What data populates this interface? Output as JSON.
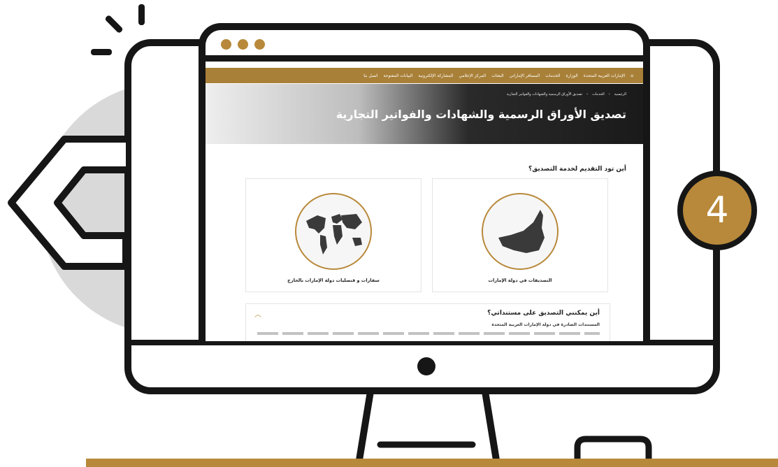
{
  "step": {
    "number": "4"
  },
  "colors": {
    "accent": "#b8893a",
    "outline": "#161616",
    "circle": "#d9d9d9"
  },
  "site": {
    "nav": [
      "الإمارات العربية المتحدة",
      "الوزارة",
      "الخدمات",
      "المسافر الإماراتي",
      "البعثات",
      "المركز الإعلامي",
      "المشاركة الإلكترونية",
      "البيانات المفتوحة",
      "اتصل بنا"
    ],
    "breadcrumb": [
      "الرئيسية",
      "الخدمات",
      "تصديق الأوراق الرسمية والشهادات والفواتير التجارية"
    ],
    "page_title": "تصديق الأوراق الرسمية والشهادات والفواتير التجارية",
    "question": "أين تود التقديم لخدمة التصديق؟",
    "cards": [
      {
        "label": "التصديقات في دولة الإمارات",
        "icon": "uae-map-icon"
      },
      {
        "label": "سفارات و قنصليات دولة الإمارات بالخارج",
        "icon": "world-map-icon"
      }
    ],
    "faq": {
      "title": "أين يمكنني التصديق على مستنداتي؟",
      "subtitle": "المستندات الصادرة في دولة الإمارات العربية المتحدة"
    }
  }
}
